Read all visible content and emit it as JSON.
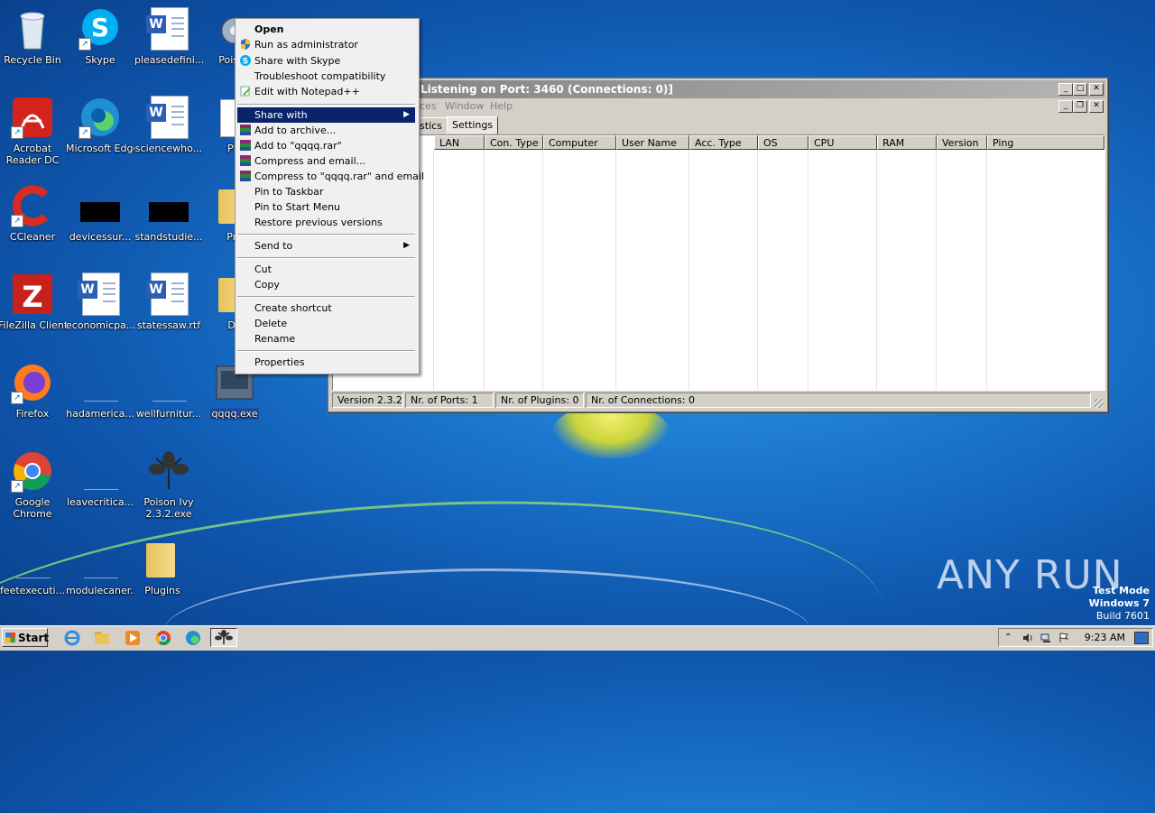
{
  "desktop_icons": [
    {
      "label": "Recycle Bin",
      "icon": "recycle-bin-icon"
    },
    {
      "label": "Skype",
      "icon": "skype-icon"
    },
    {
      "label": "pleasedefini...",
      "icon": "word-document-icon"
    },
    {
      "label": "Poison",
      "icon": "gear-icon"
    },
    {
      "label": "Acrobat Reader DC",
      "icon": "acrobat-icon"
    },
    {
      "label": "Microsoft Edge",
      "icon": "edge-icon"
    },
    {
      "label": "sciencewho...",
      "icon": "word-document-icon"
    },
    {
      "label": "PIL",
      "icon": "file-icon"
    },
    {
      "label": "CCleaner",
      "icon": "ccleaner-icon"
    },
    {
      "label": "devicessur...",
      "icon": "black-file-icon"
    },
    {
      "label": "standstudie...",
      "icon": "black-file-icon"
    },
    {
      "label": "Pro",
      "icon": "folder-icon"
    },
    {
      "label": "FileZilla Client",
      "icon": "filezilla-icon"
    },
    {
      "label": "economicpa...",
      "icon": "word-document-icon"
    },
    {
      "label": "statessaw.rtf",
      "icon": "word-document-icon"
    },
    {
      "label": "Da",
      "icon": "folder-icon"
    },
    {
      "label": "Firefox",
      "icon": "firefox-icon"
    },
    {
      "label": "hadamerica...",
      "icon": "blank-file-icon"
    },
    {
      "label": "wellfurnitur...",
      "icon": "blank-file-icon"
    },
    {
      "label": "qqqq.exe",
      "icon": "executable-icon"
    },
    {
      "label": "Google Chrome",
      "icon": "chrome-icon"
    },
    {
      "label": "leavecritica...",
      "icon": "blank-file-icon"
    },
    {
      "label": "Poison Ivy 2.3.2.exe",
      "icon": "ivy-leaf-icon"
    },
    {
      "label": "feetexecuti...",
      "icon": "blank-file-icon"
    },
    {
      "label": "modulecaner...",
      "icon": "blank-file-icon"
    },
    {
      "label": "Plugins",
      "icon": "folder-icon"
    }
  ],
  "rat_window": {
    "title": "Listening on Port: 3460 (Connections: 0)]",
    "menu": [
      "ces",
      "Window",
      "Help"
    ],
    "tabs": [
      "istics",
      "Settings"
    ],
    "columns": [
      "LAN",
      "Con. Type",
      "Computer",
      "User Name",
      "Acc. Type",
      "OS",
      "CPU",
      "RAM",
      "Version",
      "Ping"
    ],
    "status": {
      "version": "Version 2.3.2",
      "ports": "Nr. of Ports: 1",
      "plugins": "Nr. of Plugins: 0",
      "connections": "Nr. of Connections: 0"
    }
  },
  "context_menu": {
    "items": [
      {
        "label": "Open",
        "bold": true
      },
      {
        "label": "Run as administrator",
        "icon": "shield-icon"
      },
      {
        "label": "Share with Skype",
        "icon": "skype-icon"
      },
      {
        "label": "Troubleshoot compatibility"
      },
      {
        "label": "Edit with Notepad++",
        "icon": "notepad-plus-icon"
      },
      {
        "label": "Share with",
        "submenu": true,
        "highlighted": true
      },
      {
        "label": "Add to archive...",
        "icon": "winrar-icon"
      },
      {
        "label": "Add to \"qqqq.rar\"",
        "icon": "winrar-icon"
      },
      {
        "label": "Compress and email...",
        "icon": "winrar-icon"
      },
      {
        "label": "Compress to \"qqqq.rar\" and email",
        "icon": "winrar-icon"
      },
      {
        "label": "Pin to Taskbar"
      },
      {
        "label": "Pin to Start Menu"
      },
      {
        "label": "Restore previous versions"
      },
      {
        "label": "Send to",
        "submenu": true
      },
      {
        "label": "Cut"
      },
      {
        "label": "Copy"
      },
      {
        "label": "Create shortcut"
      },
      {
        "label": "Delete"
      },
      {
        "label": "Rename"
      },
      {
        "label": "Properties"
      }
    ]
  },
  "watermark": {
    "text": "ANY RUN"
  },
  "test_mode": {
    "line1": "Test Mode",
    "line2": "Windows 7",
    "line3": "Build 7601"
  },
  "taskbar": {
    "start_label": "Start",
    "quick_launch": [
      "ie-icon",
      "explorer-icon",
      "media-player-icon",
      "chrome-icon",
      "edge-icon"
    ],
    "clock": "9:23 AM"
  },
  "colors": {
    "menu_highlight": "#0a246a",
    "desktop": "#1a74cc"
  }
}
